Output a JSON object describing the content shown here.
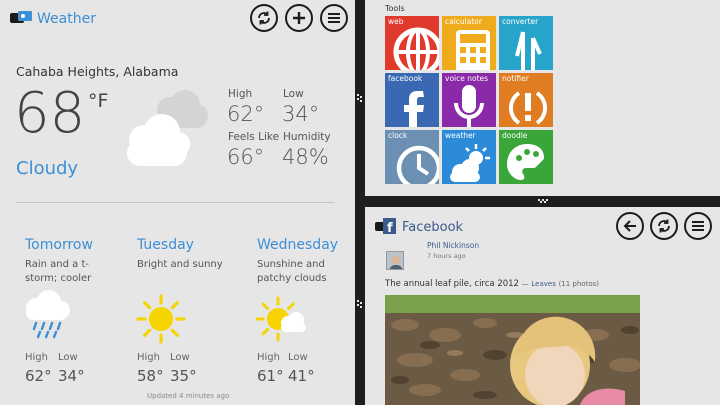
{
  "weather": {
    "app_title": "Weather",
    "location": "Cahaba Heights, Alabama",
    "current": {
      "temperature": "68",
      "unit": "°F",
      "condition": "Cloudy",
      "high_label": "High",
      "high_value": "62°",
      "low_label": "Low",
      "low_value": "34°",
      "feels_like_label": "Feels Like",
      "feels_like_value": "66°",
      "humidity_label": "Humidity",
      "humidity_value": "48%"
    },
    "forecast": [
      {
        "day": "Tomorrow",
        "desc_line1": "Rain and a t-",
        "desc_line2": "storm; cooler",
        "icon": "rain-cloud-icon",
        "high_label": "High",
        "high": "62°",
        "low_label": "Low",
        "low": "34°"
      },
      {
        "day": "Tuesday",
        "desc_line1": "Bright and sunny",
        "desc_line2": "",
        "icon": "sun-icon",
        "high_label": "High",
        "high": "58°",
        "low_label": "Low",
        "low": "35°"
      },
      {
        "day": "Wednesday",
        "desc_line1": "Sunshine and",
        "desc_line2": "patchy clouds",
        "icon": "sun-cloud-icon",
        "high_label": "High",
        "high": "61°",
        "low_label": "Low",
        "low": "41°"
      }
    ],
    "updated": "Updated 4 minutes ago",
    "buttons": [
      "refresh-icon",
      "plus-icon",
      "menu-icon"
    ],
    "accent": "#3d8fd6"
  },
  "tools": {
    "title": "Tools",
    "tiles": [
      {
        "label": "web",
        "color": "#e03a2c",
        "icon": "globe-icon"
      },
      {
        "label": "calculator",
        "color": "#f0ab1c",
        "icon": "calculator-icon"
      },
      {
        "label": "converter",
        "color": "#27a4c9",
        "icon": "converter-icon"
      },
      {
        "label": "facebook",
        "color": "#3a68b2",
        "icon": "facebook-f-icon"
      },
      {
        "label": "voice notes",
        "color": "#8a2aa8",
        "icon": "microphone-icon"
      },
      {
        "label": "notifier",
        "color": "#e07c22",
        "icon": "exclamation-icon"
      },
      {
        "label": "clock",
        "color": "#6c8fb4",
        "icon": "clock-icon"
      },
      {
        "label": "weather",
        "color": "#2b8bd8",
        "icon": "sun-cloud-icon"
      },
      {
        "label": "doodle",
        "color": "#3aa63a",
        "icon": "palette-icon"
      }
    ]
  },
  "facebook": {
    "app_title": "Facebook",
    "author": "Phil Nickinson",
    "time": "7 hours ago",
    "post_text": "The annual leaf pile, circa 2012",
    "album_dash": "—",
    "album_link": "Leaves",
    "album_count": "(11 photos)",
    "buttons": [
      "back-arrow-icon",
      "refresh-icon",
      "menu-icon"
    ],
    "brand": "#3b5a8c"
  }
}
